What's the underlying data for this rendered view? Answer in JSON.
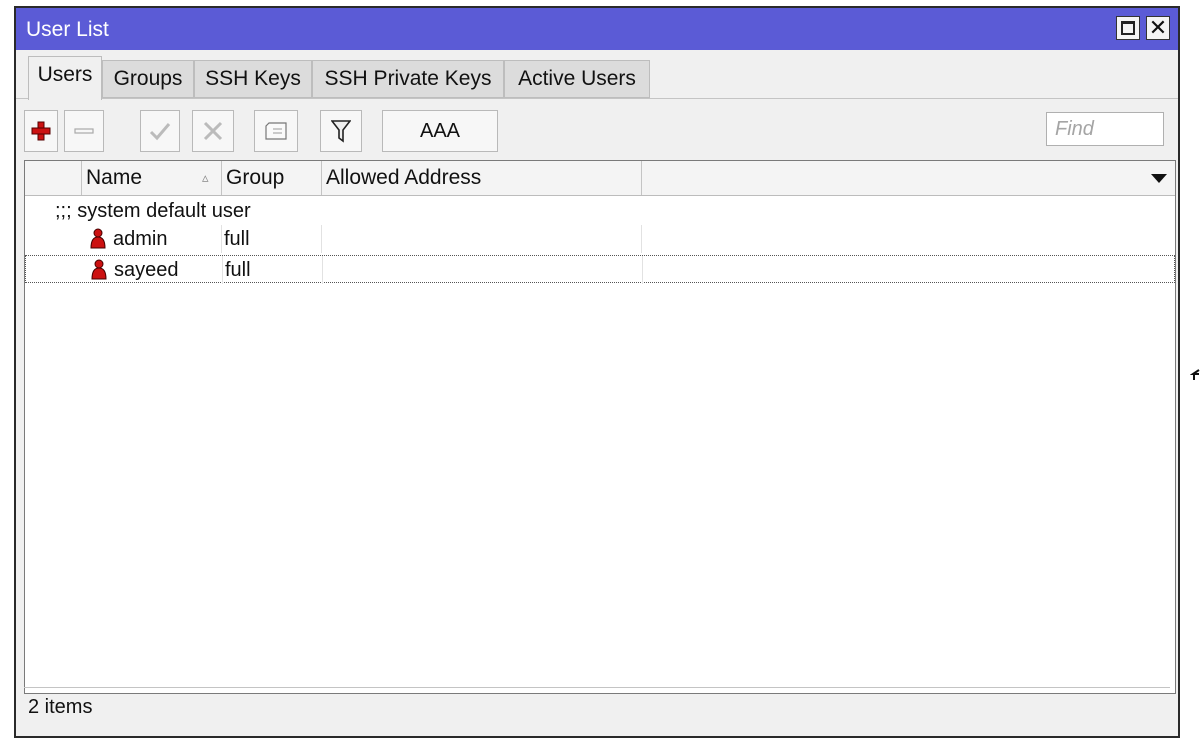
{
  "window": {
    "title": "User List"
  },
  "tabs": [
    "Users",
    "Groups",
    "SSH Keys",
    "SSH Private Keys",
    "Active Users"
  ],
  "toolbar": {
    "aaa_label": "AAA",
    "find_placeholder": "Find"
  },
  "table": {
    "columns": [
      "Name",
      "Group",
      "Allowed Address"
    ],
    "comment": ";;; system default user",
    "rows": [
      {
        "name": "admin",
        "group": "full",
        "allowed_address": ""
      },
      {
        "name": "sayeed",
        "group": "full",
        "allowed_address": ""
      }
    ]
  },
  "status": {
    "items_text": "2 items"
  },
  "colors": {
    "titlebar": "#5b5bd6",
    "add_icon": "#cc1111",
    "user_icon": "#cc1111"
  },
  "icons": {
    "add": "plus-icon",
    "remove": "minus-icon",
    "enable": "check-icon",
    "disable": "x-icon",
    "comment": "comment-icon",
    "filter": "filter-icon",
    "user": "user-icon"
  }
}
